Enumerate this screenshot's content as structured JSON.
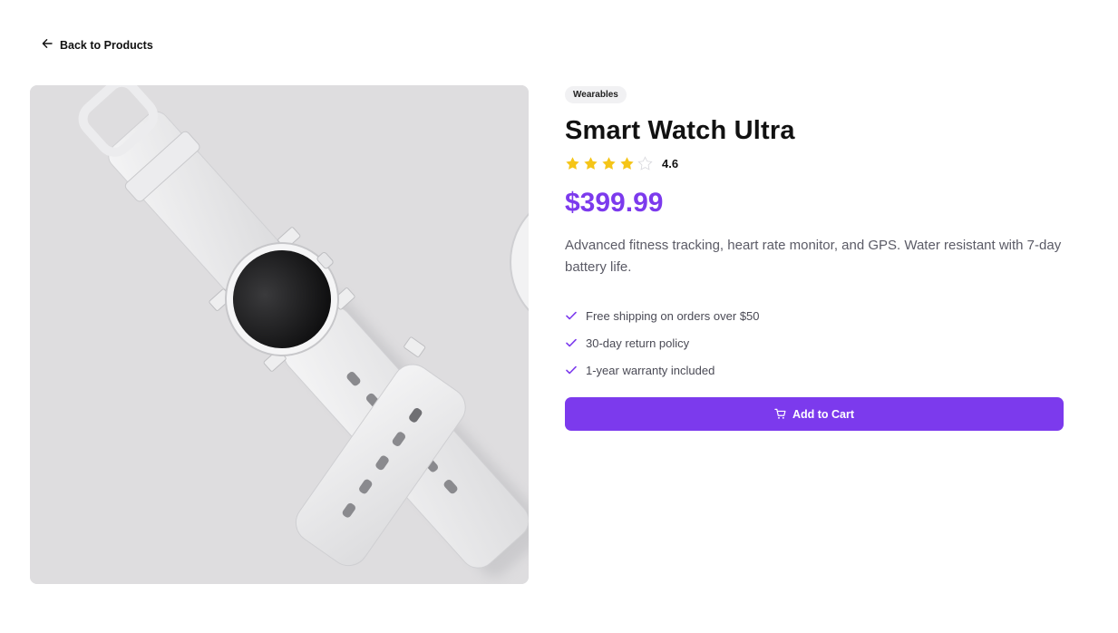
{
  "nav": {
    "back_label": "Back to Products",
    "back_icon": "arrow-left-icon"
  },
  "product": {
    "category": "Wearables",
    "name": "Smart Watch Ultra",
    "rating": 4.6,
    "rating_label": "4.6",
    "stars_total": 5,
    "stars_filled": 4,
    "price": "$399.99",
    "description": "Advanced fitness tracking, heart rate monitor, and GPS. Water resistant with 7-day battery life.",
    "image_alt": "White smart watch on a light gray background"
  },
  "features": [
    {
      "label": "Free shipping on orders over $50",
      "icon": "check-icon"
    },
    {
      "label": "30-day return policy",
      "icon": "check-icon"
    },
    {
      "label": "1-year warranty included",
      "icon": "check-icon"
    }
  ],
  "cart": {
    "button_label": "Add to Cart",
    "icon": "cart-icon"
  },
  "colors": {
    "accent": "#7c3aed",
    "star": "#f5c518",
    "star_empty": "#d9d9de",
    "image_bg": "#dedddf"
  }
}
